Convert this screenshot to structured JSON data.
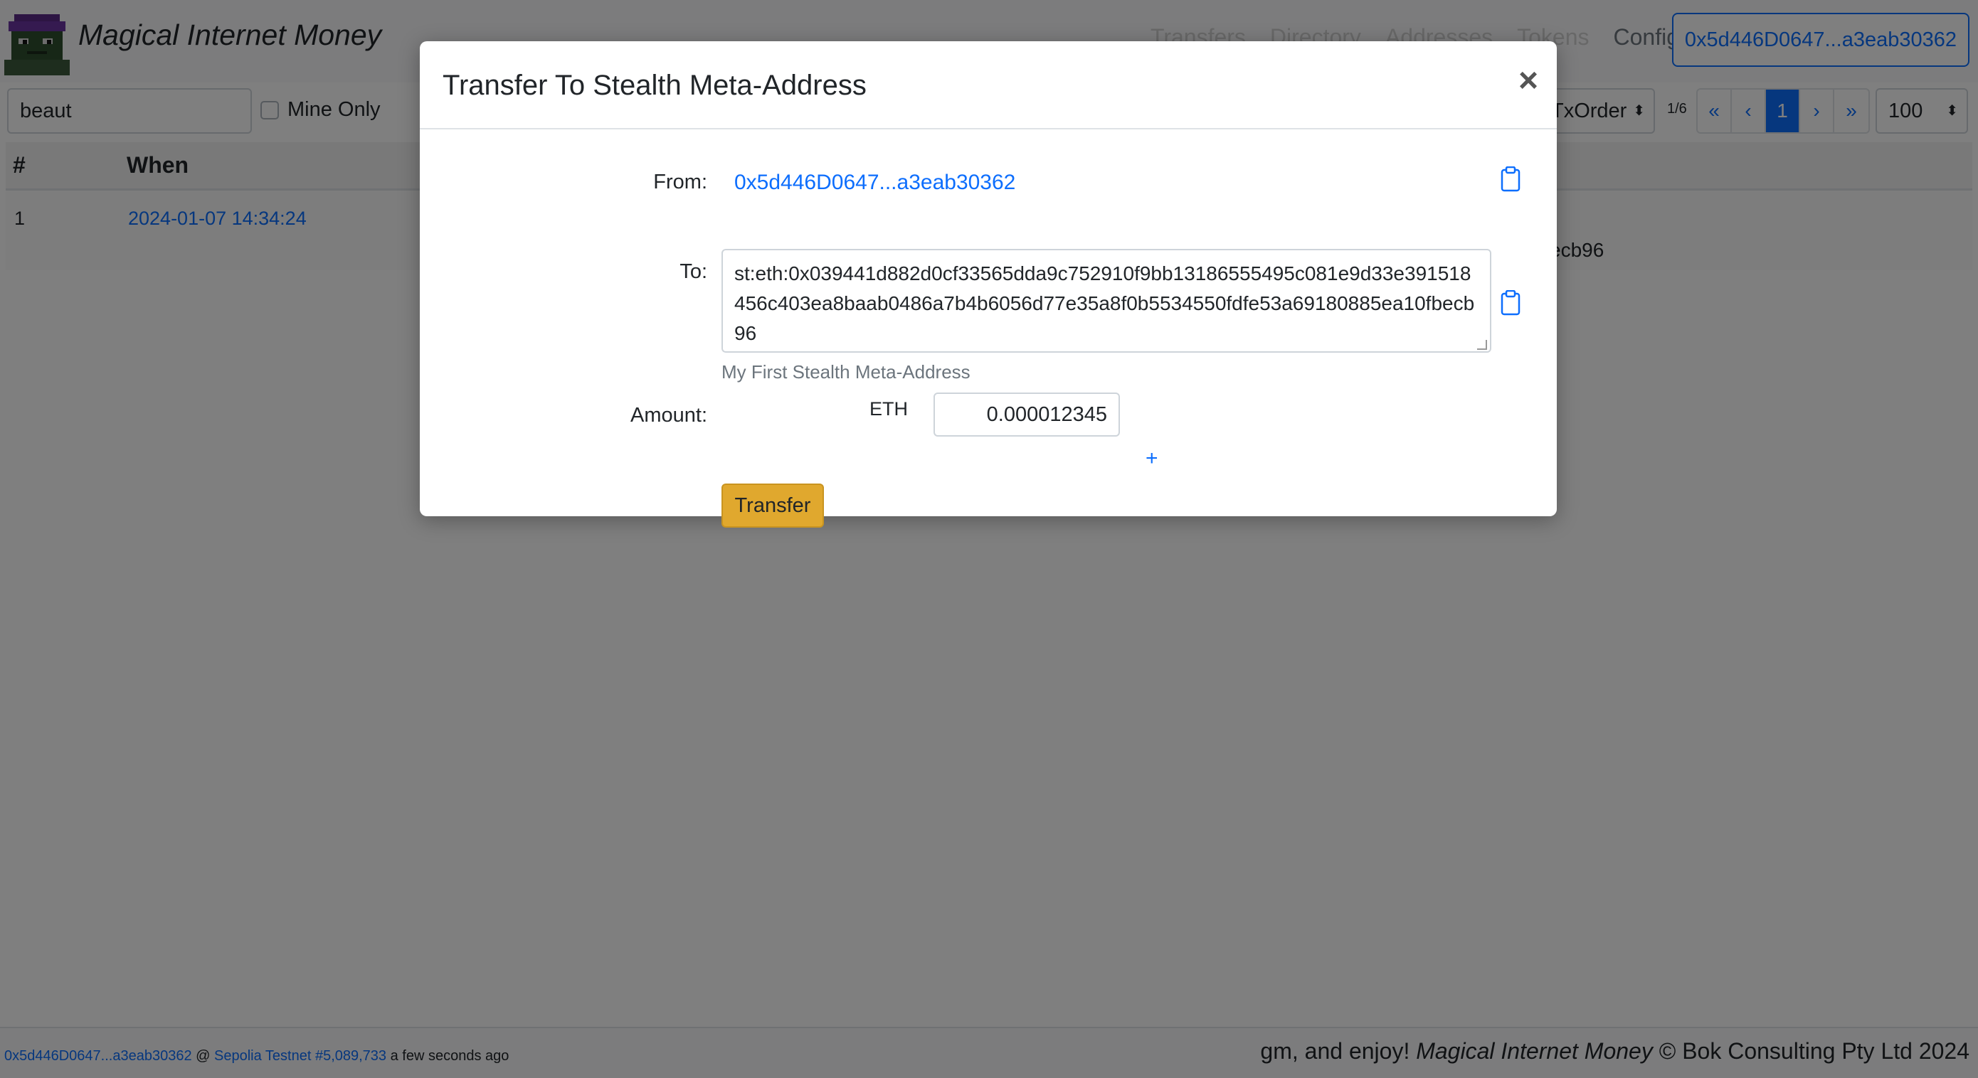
{
  "app": {
    "brand": "Magical Internet Money",
    "account_button": "0x5d446D0647...a3eab30362"
  },
  "nav": {
    "items": [
      {
        "label": "Transfers",
        "state": "overlaid"
      },
      {
        "label": "Directory",
        "state": "active-overlaid"
      },
      {
        "label": "Addresses",
        "state": "overlaid"
      },
      {
        "label": "Tokens",
        "state": "overlaid"
      },
      {
        "label": "Config",
        "state": "normal"
      }
    ]
  },
  "toolbar": {
    "search_value": "beaut",
    "mine_only_label": "Mine Only",
    "sort_label": "TxOrder",
    "page_info": "1/6",
    "pager": [
      "«",
      "‹",
      "1",
      "›",
      "»"
    ],
    "page_size": "100"
  },
  "table": {
    "headers": [
      "#",
      "When"
    ],
    "rows": [
      {
        "num": "1",
        "when": "2024-01-07 14:34:24",
        "tail": "ecb96"
      }
    ]
  },
  "modal": {
    "title": "Transfer To Stealth Meta-Address",
    "close": "×",
    "from_label": "From:",
    "from_value": "0x5d446D0647...a3eab30362",
    "to_label": "To:",
    "to_value": "st:eth:0x039441d882d0cf33565dda9c752910f9bb13186555495c081e9d33e391518456c403ea8baab0486a7b4b6056d77e35a8f0b5534550fdfe53a69180885ea10fbecb96",
    "to_note": "My First Stealth Meta-Address",
    "amount_label": "Amount:",
    "amount_unit": "ETH",
    "amount_value": "0.000012345",
    "add_label": "+",
    "transfer_label": "Transfer"
  },
  "footer": {
    "account": "0x5d446D0647...a3eab30362",
    "at": " @ ",
    "network": "Sepolia Testnet #5,089,733",
    "time": " a few seconds ago",
    "right_prefix": "gm, and enjoy! ",
    "right_brand": "Magical Internet Money",
    "right_suffix": " © Bok Consulting Pty Ltd 2024"
  },
  "colors": {
    "primary": "#0d6efd",
    "transfer_button": "#e0a82e",
    "backdrop": "rgba(0,0,0,0.5)"
  }
}
